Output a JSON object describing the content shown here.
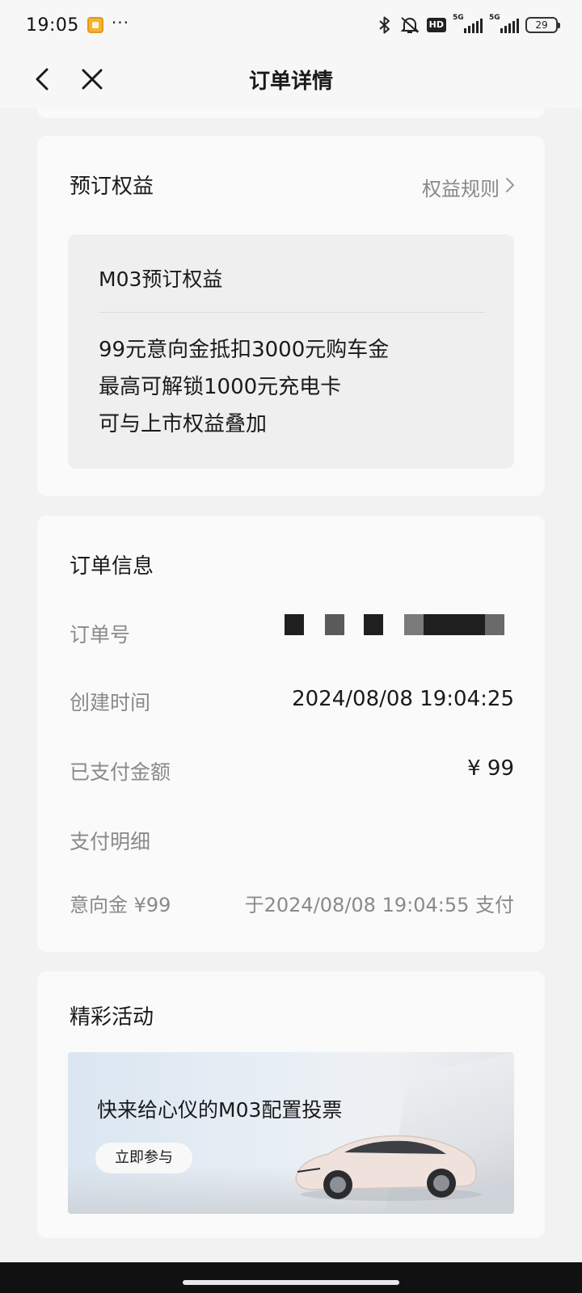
{
  "status_bar": {
    "time": "19:05",
    "dots": "···",
    "hd_label": "HD",
    "network_1": "5G",
    "network_2": "5G",
    "battery": "29",
    "icons": [
      "app-notification-icon",
      "bluetooth-icon",
      "mute-icon",
      "hd-icon",
      "signal-icon",
      "signal-icon",
      "battery-icon"
    ]
  },
  "nav": {
    "title": "订单详情",
    "back_icon": "chevron-left-icon",
    "close_icon": "close-icon"
  },
  "benefits_card": {
    "title": "预订权益",
    "rules_link": "权益规则",
    "inner_title": "M03预订权益",
    "lines": [
      "99元意向金抵扣3000元购车金",
      "最高可解锁1000元充电卡",
      "可与上市权益叠加"
    ]
  },
  "order_card": {
    "title": "订单信息",
    "order_no_label": "订单号",
    "created_label": "创建时间",
    "created_value": "2024/08/08 19:04:25",
    "paid_label": "已支付金额",
    "paid_value": "¥ 99",
    "detail_label": "支付明细",
    "detail_item_label": "意向金 ¥99",
    "detail_item_value": "于2024/08/08 19:04:55 支付"
  },
  "activity_card": {
    "title": "精彩活动",
    "banner_title": "快来给心仪的M03配置投票",
    "banner_button": "立即参与"
  },
  "colors": {
    "background": "#f2f2f2",
    "card": "#fafafa",
    "inner_box": "#efefef",
    "secondary_text": "#8a8a8a",
    "bottom_bar": "#111111"
  }
}
